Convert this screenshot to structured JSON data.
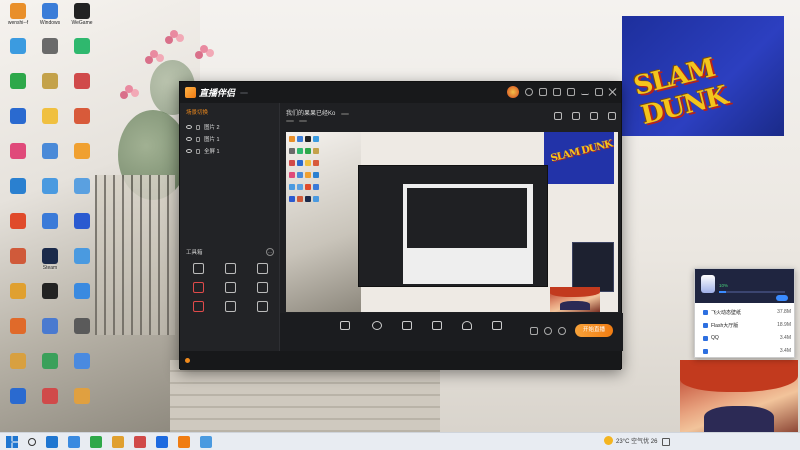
{
  "desktop": {
    "icons": [
      {
        "label": "wenshi--f",
        "color": "#e98f2a"
      },
      {
        "label": "Windows",
        "color": "#3b7dd8"
      },
      {
        "label": "WeGame",
        "color": "#222222"
      },
      {
        "label": "",
        "color": "#3b9be0"
      },
      {
        "label": "",
        "color": "#6a6a6a"
      },
      {
        "label": "",
        "color": "#2fb86e"
      },
      {
        "label": "",
        "color": "#2ea84a"
      },
      {
        "label": "",
        "color": "#c4a24a"
      },
      {
        "label": "",
        "color": "#d04a4a"
      },
      {
        "label": "",
        "color": "#2a6ad0"
      },
      {
        "label": "",
        "color": "#f0c040"
      },
      {
        "label": "",
        "color": "#d85a3a"
      },
      {
        "label": "",
        "color": "#e04a7a"
      },
      {
        "label": "",
        "color": "#4a8ad8"
      },
      {
        "label": "",
        "color": "#f0a030"
      },
      {
        "label": "",
        "color": "#2a80d0"
      },
      {
        "label": "",
        "color": "#4a9ae0"
      },
      {
        "label": "",
        "color": "#5aa0e0"
      },
      {
        "label": "",
        "color": "#e04a2a"
      },
      {
        "label": "",
        "color": "#3a7ad8"
      },
      {
        "label": "",
        "color": "#2a5ad0"
      },
      {
        "label": "",
        "color": "#d05a3a"
      },
      {
        "label": "Steam",
        "color": "#1b2a4a"
      },
      {
        "label": "",
        "color": "#4a9ae0"
      },
      {
        "label": "",
        "color": "#e0a030"
      },
      {
        "label": "",
        "color": "#222222"
      },
      {
        "label": "",
        "color": "#3a8ae0"
      },
      {
        "label": "",
        "color": "#e06a2a"
      },
      {
        "label": "",
        "color": "#4a7ad0"
      },
      {
        "label": "",
        "color": "#5a5a5a"
      },
      {
        "label": "",
        "color": "#d8a040"
      },
      {
        "label": "",
        "color": "#3aa05a"
      },
      {
        "label": "",
        "color": "#4a8ae0"
      },
      {
        "label": "",
        "color": "#2a6ad0"
      },
      {
        "label": "",
        "color": "#d04a4a"
      },
      {
        "label": "",
        "color": "#e0a040"
      }
    ]
  },
  "app": {
    "name": "直播伴侣",
    "version_badge": "",
    "left_tabs": [
      "场景切换",
      "",
      ""
    ],
    "scenes": [
      "图片 2",
      "图片 1",
      "全屏 1"
    ],
    "tools_title": "工具箱",
    "tools": [
      "",
      "",
      "",
      "",
      "",
      "",
      "",
      "",
      ""
    ],
    "room": {
      "title": "我们的果果已经Ko",
      "edit": "",
      "tags": [
        "",
        ""
      ],
      "meta": [
        "",
        ""
      ]
    },
    "controls": [
      {
        "label": ""
      },
      {
        "label": ""
      },
      {
        "label": ""
      },
      {
        "label": ""
      },
      {
        "label": ""
      },
      {
        "label": ""
      }
    ],
    "live_button": "开始直播",
    "status_notice": "",
    "status_link": "",
    "status_stats": [
      "",
      ""
    ]
  },
  "popup": {
    "title": "",
    "subtitle_prefix": "",
    "percent": "10%",
    "progress": 0.1,
    "checkbox_label": "",
    "rows": [
      {
        "name": "飞火动态壁纸",
        "size": "37.8M"
      },
      {
        "name": "Flash大厅版",
        "size": "18.9M"
      },
      {
        "name": "QQ",
        "size": "3.4M"
      },
      {
        "name": "",
        "size": "3.4M"
      }
    ]
  },
  "decor": {
    "slam_text": "SLAM DUNK"
  },
  "taskbar": {
    "weather": "23°C 空气优 26",
    "apps": [
      {
        "color": "#1f76d1"
      },
      {
        "color": "#3a8ae0"
      },
      {
        "color": "#2ea84a"
      },
      {
        "color": "#e0a030"
      },
      {
        "color": "#d04a4a"
      },
      {
        "color": "#1d6ae0"
      },
      {
        "color": "#f07c12"
      },
      {
        "color": "#4a9ae0"
      }
    ]
  }
}
